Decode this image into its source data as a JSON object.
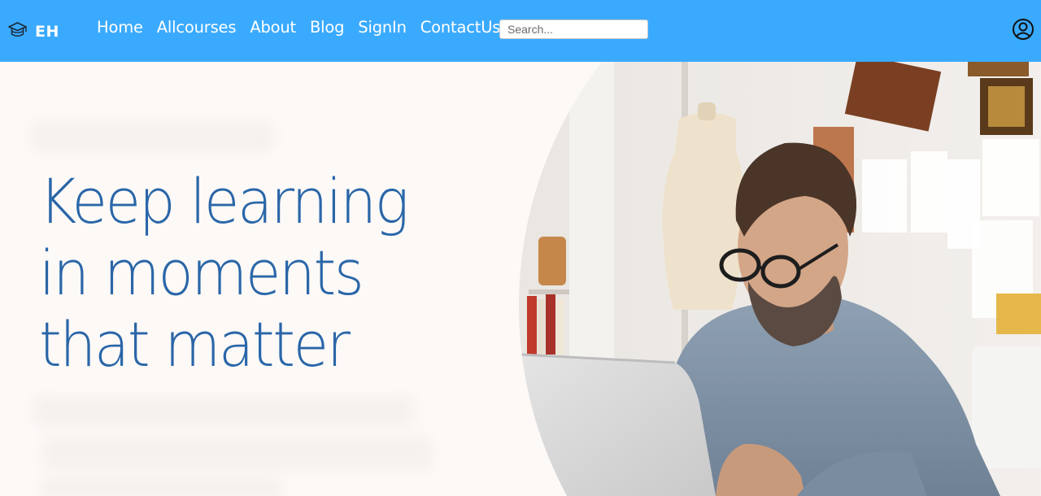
{
  "brand": {
    "text": "EH",
    "icon": "graduation-cap-icon"
  },
  "nav": {
    "items": [
      {
        "label": "Home"
      },
      {
        "label": "Allcourses"
      },
      {
        "label": "About"
      },
      {
        "label": "Blog"
      },
      {
        "label": "SignIn"
      },
      {
        "label": "ContactUs"
      }
    ]
  },
  "search": {
    "placeholder": "Search...",
    "value": ""
  },
  "profile": {
    "icon": "user-circle-icon"
  },
  "hero": {
    "title_lines": [
      "Keep learning",
      "in moments",
      "that matter"
    ],
    "image": {
      "icon": "man-with-laptop-photo"
    }
  },
  "colors": {
    "navbar": "#3aaaff",
    "title": "#2a66a8",
    "background": "#fdf9f7"
  }
}
